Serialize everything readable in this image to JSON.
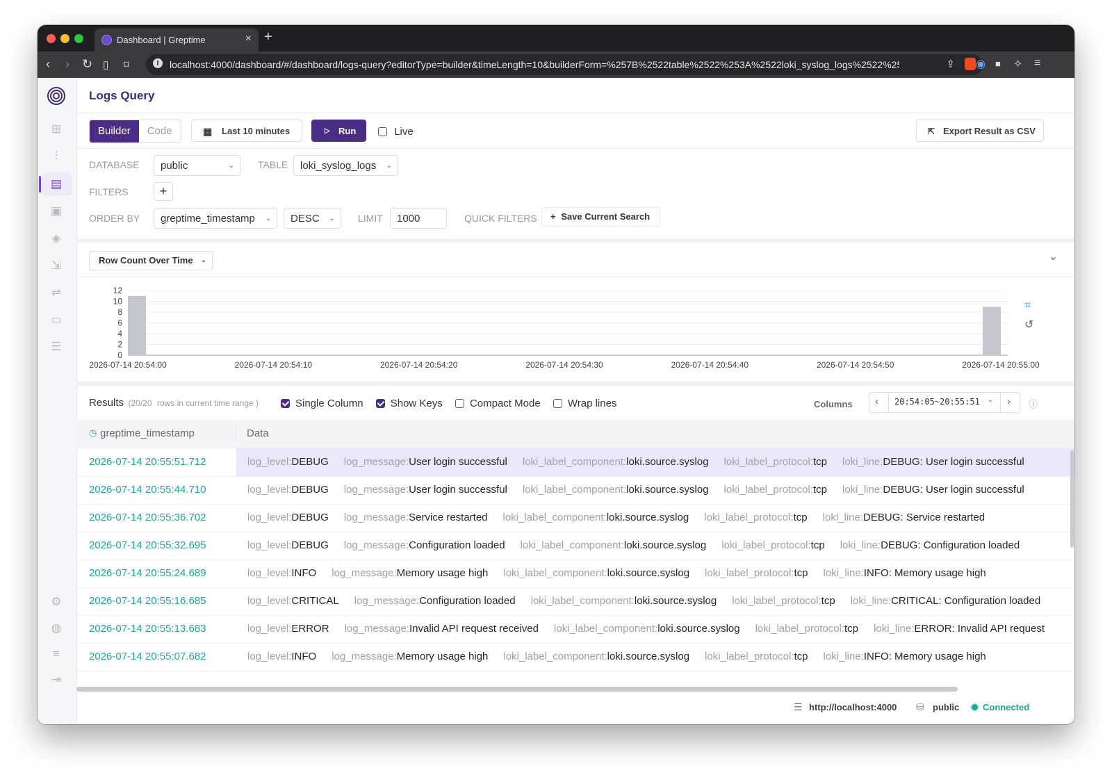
{
  "browser": {
    "tab_title": "Dashboard | Greptime",
    "url": "localhost:4000/dashboard/#/dashboard/logs-query?editorType=builder&timeLength=10&builderForm=%257B%2522table%2522%253A%2522loki_syslog_logs%2522%25..."
  },
  "page": {
    "title": "Logs Query"
  },
  "toolbar": {
    "mode_builder": "Builder",
    "mode_code": "Code",
    "time_range": "Last 10 minutes",
    "run_label": "Run",
    "live_label": "Live",
    "export_label": "Export Result as CSV"
  },
  "form": {
    "database_label": "DATABASE",
    "database_value": "public",
    "table_label": "TABLE",
    "table_value": "loki_syslog_logs",
    "filters_label": "FILTERS",
    "order_by_label": "ORDER BY",
    "order_by_value": "greptime_timestamp",
    "order_dir": "DESC",
    "limit_label": "LIMIT",
    "limit_value": "1000",
    "quick_filters_label": "QUICK FILTERS",
    "save_search_label": "Save Current Search"
  },
  "chart_header": {
    "dropdown_label": "Row Count Over Time"
  },
  "chart_data": {
    "type": "bar",
    "title": "",
    "xlabel": "",
    "ylabel": "",
    "ylim": [
      0,
      12
    ],
    "y_ticks": [
      "12",
      "10",
      "8",
      "6",
      "4",
      "2",
      "0"
    ],
    "x_ticks": [
      "2026-07-14 20:54:00",
      "2026-07-14 20:54:10",
      "2026-07-14 20:54:20",
      "2026-07-14 20:54:30",
      "2026-07-14 20:54:40",
      "2026-07-14 20:54:50",
      "2026-07-14 20:55:00"
    ],
    "bars": [
      {
        "x": "2026-07-14 20:54:00",
        "value": 11
      },
      {
        "x": "2026-07-14 20:55:00",
        "value": 9
      }
    ],
    "bar_color": "#c5c7cf"
  },
  "results": {
    "label": "Results",
    "count": "(20/20",
    "count_suffix": "rows in current time range )",
    "single_column": "Single Column",
    "show_keys": "Show Keys",
    "compact_mode": "Compact Mode",
    "wrap_lines": "Wrap lines",
    "columns_label": "Columns",
    "time_window": "20:54:05~20:55:51",
    "col_timestamp": "greptime_timestamp",
    "col_data": "Data",
    "rows": [
      {
        "ts": "2026-07-14 20:55:51.712",
        "level": "DEBUG",
        "message": "User login successful",
        "component": "loki.source.syslog",
        "protocol": "tcp",
        "line": "DEBUG: User login successful"
      },
      {
        "ts": "2026-07-14 20:55:44.710",
        "level": "DEBUG",
        "message": "User login successful",
        "component": "loki.source.syslog",
        "protocol": "tcp",
        "line": "DEBUG: User login successful"
      },
      {
        "ts": "2026-07-14 20:55:36.702",
        "level": "DEBUG",
        "message": "Service restarted",
        "component": "loki.source.syslog",
        "protocol": "tcp",
        "line": "DEBUG: Service restarted"
      },
      {
        "ts": "2026-07-14 20:55:32.695",
        "level": "DEBUG",
        "message": "Configuration loaded",
        "component": "loki.source.syslog",
        "protocol": "tcp",
        "line": "DEBUG: Configuration loaded"
      },
      {
        "ts": "2026-07-14 20:55:24.689",
        "level": "INFO",
        "message": "Memory usage high",
        "component": "loki.source.syslog",
        "protocol": "tcp",
        "line": "INFO: Memory usage high"
      },
      {
        "ts": "2026-07-14 20:55:16.685",
        "level": "CRITICAL",
        "message": "Configuration loaded",
        "component": "loki.source.syslog",
        "protocol": "tcp",
        "line": "CRITICAL: Configuration loaded"
      },
      {
        "ts": "2026-07-14 20:55:13.683",
        "level": "ERROR",
        "message": "Invalid API request received",
        "component": "loki.source.syslog",
        "protocol": "tcp",
        "line": "ERROR: Invalid API request"
      },
      {
        "ts": "2026-07-14 20:55:07.682",
        "level": "INFO",
        "message": "Memory usage high",
        "component": "loki.source.syslog",
        "protocol": "tcp",
        "line": "INFO: Memory usage high"
      }
    ],
    "keys": {
      "level": "log_level:",
      "message": "log_message:",
      "component": "loki_label_component:",
      "protocol": "loki_label_protocol:",
      "line": "loki_line:"
    }
  },
  "status": {
    "host": "http://localhost:4000",
    "db": "public",
    "connection": "Connected"
  },
  "colors": {
    "accent": "#4a2d86",
    "timestamp": "#1ba89a",
    "connected": "#1ba89a"
  }
}
